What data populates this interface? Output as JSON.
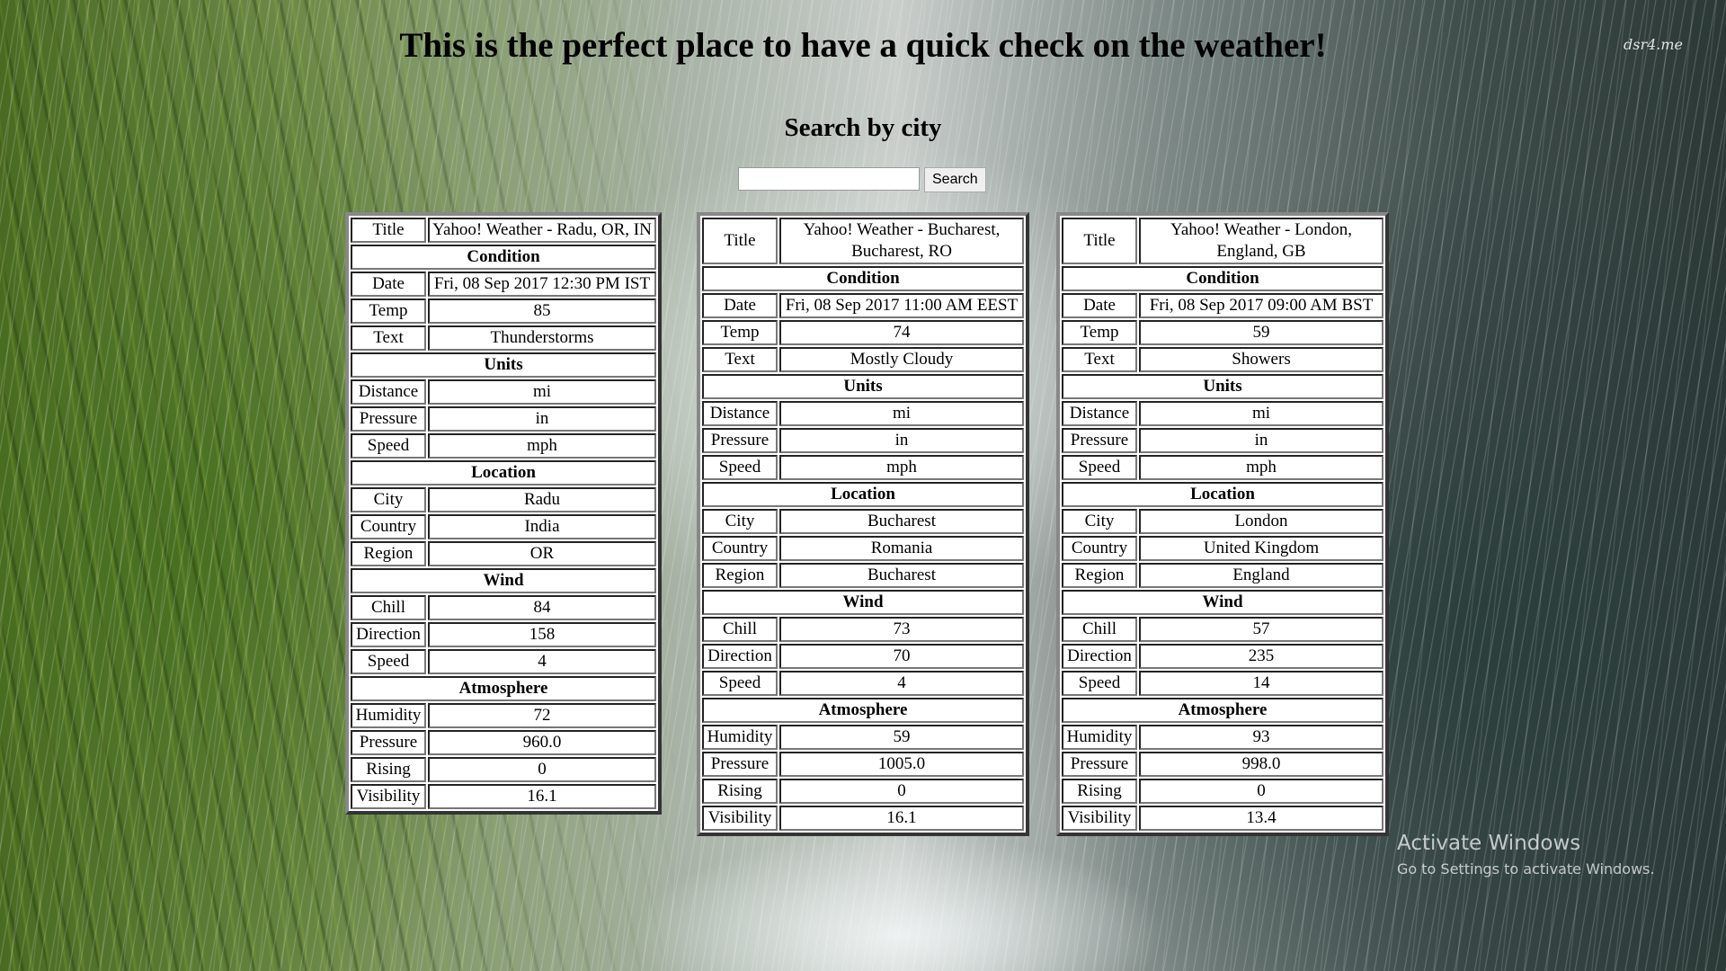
{
  "page": {
    "heading": "This is the perfect place to have a quick check on the weather!",
    "subheading": "Search by city",
    "watermark": "dsr4.me"
  },
  "search": {
    "value": "",
    "placeholder": "",
    "button_label": "Search"
  },
  "labels": {
    "title": "Title",
    "condition": "Condition",
    "date": "Date",
    "temp": "Temp",
    "text": "Text",
    "units": "Units",
    "distance": "Distance",
    "pressure": "Pressure",
    "speed": "Speed",
    "location": "Location",
    "city": "City",
    "country": "Country",
    "region": "Region",
    "wind": "Wind",
    "chill": "Chill",
    "direction": "Direction",
    "atmosphere": "Atmosphere",
    "humidity": "Humidity",
    "rising": "Rising",
    "visibility": "Visibility"
  },
  "cities": [
    {
      "title": "Yahoo! Weather - Radu, OR, IN",
      "condition": {
        "date": "Fri, 08 Sep 2017 12:30 PM IST",
        "temp": "85",
        "text": "Thunderstorms"
      },
      "units": {
        "distance": "mi",
        "pressure": "in",
        "speed": "mph"
      },
      "location": {
        "city": "Radu",
        "country": "India",
        "region": "OR"
      },
      "wind": {
        "chill": "84",
        "direction": "158",
        "speed": "4"
      },
      "atmosphere": {
        "humidity": "72",
        "pressure": "960.0",
        "rising": "0",
        "visibility": "16.1"
      }
    },
    {
      "title": "Yahoo! Weather - Bucharest, Bucharest, RO",
      "condition": {
        "date": "Fri, 08 Sep 2017 11:00 AM EEST",
        "temp": "74",
        "text": "Mostly Cloudy"
      },
      "units": {
        "distance": "mi",
        "pressure": "in",
        "speed": "mph"
      },
      "location": {
        "city": "Bucharest",
        "country": "Romania",
        "region": "Bucharest"
      },
      "wind": {
        "chill": "73",
        "direction": "70",
        "speed": "4"
      },
      "atmosphere": {
        "humidity": "59",
        "pressure": "1005.0",
        "rising": "0",
        "visibility": "16.1"
      }
    },
    {
      "title": "Yahoo! Weather - London, England, GB",
      "condition": {
        "date": "Fri, 08 Sep 2017 09:00 AM BST",
        "temp": "59",
        "text": "Showers"
      },
      "units": {
        "distance": "mi",
        "pressure": "in",
        "speed": "mph"
      },
      "location": {
        "city": "London",
        "country": "United Kingdom",
        "region": "England"
      },
      "wind": {
        "chill": "57",
        "direction": "235",
        "speed": "14"
      },
      "atmosphere": {
        "humidity": "93",
        "pressure": "998.0",
        "rising": "0",
        "visibility": "13.4"
      }
    }
  ],
  "windows_notice": {
    "title": "Activate Windows",
    "subtitle": "Go to Settings to activate Windows."
  }
}
